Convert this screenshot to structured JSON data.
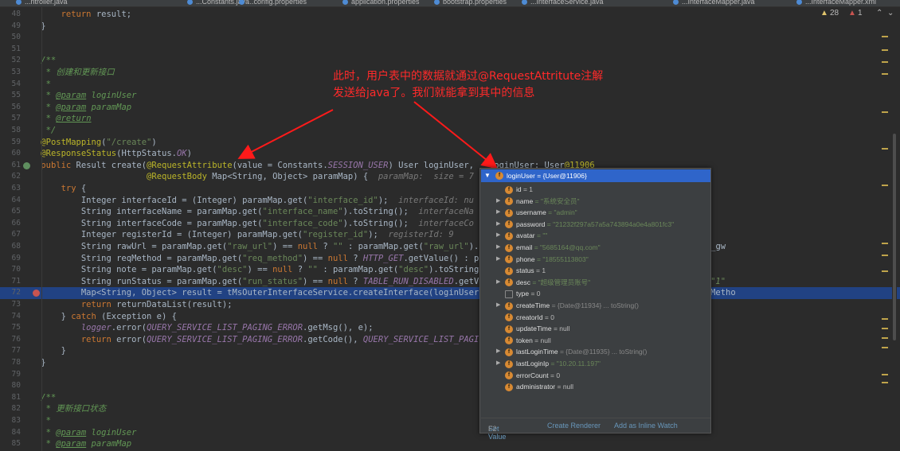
{
  "tabs": [
    "...ntroller.java",
    "...Constants.java",
    "...config.properties",
    "application.properties",
    "bootstrap.properties",
    "...InterfaceService.java",
    "...InterfaceMapper.java",
    "...InterfaceMapper.xml"
  ],
  "inspections": {
    "warnings": "28",
    "errors": "1",
    "up": "⌃",
    "down": "⌄"
  },
  "code_lines": [
    {
      "n": "48",
      "t": "        return result;"
    },
    {
      "n": "49",
      "t": "    }"
    },
    {
      "n": "50",
      "t": ""
    },
    {
      "n": "51",
      "t": ""
    },
    {
      "n": "52",
      "t": "    /**"
    },
    {
      "n": "53",
      "t": "     * 创建和更新接口"
    },
    {
      "n": "54",
      "t": "     *"
    },
    {
      "n": "55",
      "t": "     * @param loginUser"
    },
    {
      "n": "56",
      "t": "     * @param paramMap"
    },
    {
      "n": "57",
      "t": "     * @return"
    },
    {
      "n": "58",
      "t": "     */"
    },
    {
      "n": "59",
      "t": "    @PostMapping(\"/create\")"
    },
    {
      "n": "60",
      "t": "    @ResponseStatus(HttpStatus.OK)"
    },
    {
      "n": "61",
      "t": "    public Result create(@RequestAttribute(value = Constants.SESSION_USER) User loginUser,   loginUser: User@11906"
    },
    {
      "n": "62",
      "t": "                         @RequestBody Map<String, Object> paramMap) {  paramMap:  size = 7"
    },
    {
      "n": "63",
      "t": "        try {"
    },
    {
      "n": "64",
      "t": "            Integer interfaceId = (Integer) paramMap.get(\"interface_id\");  interfaceId: nu"
    },
    {
      "n": "65",
      "t": "            String interfaceName = paramMap.get(\"interface_name\").toString();  interfaceNa"
    },
    {
      "n": "66",
      "t": "            String interfaceCode = paramMap.get(\"interface_code\").toString();  interfaceCo"
    },
    {
      "n": "67",
      "t": "            Integer registerId = (Integer) paramMap.get(\"register_id\");  registerId: 9"
    },
    {
      "n": "68",
      "t": "            String rawUrl = paramMap.get(\"raw_url\") == null ? \"\" : paramMap.get(\"raw_url\").            -consumer/encapsula/v1/service/jsr_gw"
    },
    {
      "n": "69",
      "t": "            String reqMethod = paramMap.get(\"req_method\") == null ? HTTP_GET.getValue() : p                  \"1\""
    },
    {
      "n": "70",
      "t": "            String note = paramMap.get(\"desc\") == null ? \"\" : paramMap.get(\"desc\").toString"
    },
    {
      "n": "71",
      "t": "            String runStatus = paramMap.get(\"run_status\") == null ? TABLE_RUN_DISABLED.getV             paramMap:  size = 7   runStatus: \"1\""
    },
    {
      "n": "72",
      "t": "            Map<String, Object> result = tMsOuterInterfaceService.createInterface(loginUser             faceCode, registerId, rawUrl, reqMetho"
    },
    {
      "n": "73",
      "t": "            return returnDataList(result);"
    },
    {
      "n": "74",
      "t": "        } catch (Exception e) {"
    },
    {
      "n": "75",
      "t": "            logger.error(QUERY_SERVICE_LIST_PAGING_ERROR.getMsg(), e);"
    },
    {
      "n": "76",
      "t": "            return error(QUERY_SERVICE_LIST_PAGING_ERROR.getCode(), QUERY_SERVICE_LIST_PAGI"
    },
    {
      "n": "77",
      "t": "        }"
    },
    {
      "n": "78",
      "t": "    }"
    },
    {
      "n": "79",
      "t": ""
    },
    {
      "n": "80",
      "t": ""
    },
    {
      "n": "81",
      "t": "    /**"
    },
    {
      "n": "82",
      "t": "     * 更新接口状态"
    },
    {
      "n": "83",
      "t": "     *"
    },
    {
      "n": "84",
      "t": "     * @param loginUser"
    },
    {
      "n": "85",
      "t": "     * @param paramMap"
    }
  ],
  "annotation": {
    "line1": "此时，用户表中的数据就通过@RequestAttritute注解",
    "line2": "发送给java了。我们就能拿到其中的信息"
  },
  "debug_popup": {
    "header": "loginUser = {User@11906}",
    "fields": [
      {
        "name": "id",
        "value": "= 1",
        "kind": "plain",
        "expand": false
      },
      {
        "name": "name",
        "value": "= \"系统安全员\"",
        "kind": "string",
        "expand": true
      },
      {
        "name": "username",
        "value": "= \"admin\"",
        "kind": "string",
        "expand": true
      },
      {
        "name": "password",
        "value": "= \"21232f297a57a5a743894a0e4a801fc3\"",
        "kind": "string",
        "expand": true
      },
      {
        "name": "avatar",
        "value": "= \"\"",
        "kind": "string",
        "expand": true
      },
      {
        "name": "email",
        "value": "= \"5685164@qq.com\"",
        "kind": "string",
        "expand": true
      },
      {
        "name": "phone",
        "value": "= \"18555113803\"",
        "kind": "string",
        "expand": true
      },
      {
        "name": "status",
        "value": "= 1",
        "kind": "plain",
        "expand": false
      },
      {
        "name": "desc",
        "value": "= \"超级管理员账号\"",
        "kind": "string",
        "expand": true
      },
      {
        "name": "type",
        "value": "= 0",
        "kind": "plain",
        "expand": false,
        "icon": "type"
      },
      {
        "name": "createTime",
        "value": "= {Date@11934} ... toString()",
        "kind": "object",
        "expand": true
      },
      {
        "name": "creatorId",
        "value": "= 0",
        "kind": "plain",
        "expand": false
      },
      {
        "name": "updateTime",
        "value": "= null",
        "kind": "plain",
        "expand": false
      },
      {
        "name": "token",
        "value": "= null",
        "kind": "plain",
        "expand": false
      },
      {
        "name": "lastLoginTime",
        "value": "= {Date@11935} ... toString()",
        "kind": "object",
        "expand": true
      },
      {
        "name": "lastLoginIp",
        "value": "= \"10.20.11.197\"",
        "kind": "string",
        "expand": true
      },
      {
        "name": "errorCount",
        "value": "= 0",
        "kind": "plain",
        "expand": false
      },
      {
        "name": "administrator",
        "value": "= null",
        "kind": "plain",
        "expand": false
      }
    ],
    "footer": {
      "set_value": "Set Value",
      "set_value_key": "F2",
      "create_renderer": "Create Renderer",
      "add_inline_watch": "Add as Inline Watch"
    }
  },
  "colors": {
    "editor_bg": "#2b2b2b",
    "selected_line": "#214283",
    "annotation_red": "#ff2a2a",
    "popup_header": "#2f65ca"
  }
}
